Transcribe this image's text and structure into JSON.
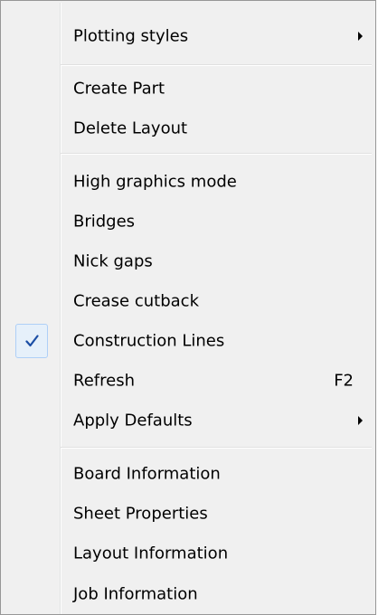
{
  "context_menu": {
    "items": [
      {
        "label": "Plotting styles",
        "icon": "submenu-arrow-icon"
      },
      {
        "label": "Create Part"
      },
      {
        "label": "Delete Layout"
      },
      {
        "label": "High graphics mode"
      },
      {
        "label": "Bridges"
      },
      {
        "label": "Nick gaps"
      },
      {
        "label": "Crease cutback"
      },
      {
        "label": "Construction Lines",
        "checked": true,
        "icon": "checkmark-icon"
      },
      {
        "label": "Refresh",
        "shortcut": "F2"
      },
      {
        "label": "Apply Defaults",
        "icon": "submenu-arrow-icon"
      },
      {
        "label": "Board Information"
      },
      {
        "label": "Sheet Properties"
      },
      {
        "label": "Layout Information"
      },
      {
        "label": "Job Information"
      }
    ],
    "check_color": "#1c4ea5"
  }
}
